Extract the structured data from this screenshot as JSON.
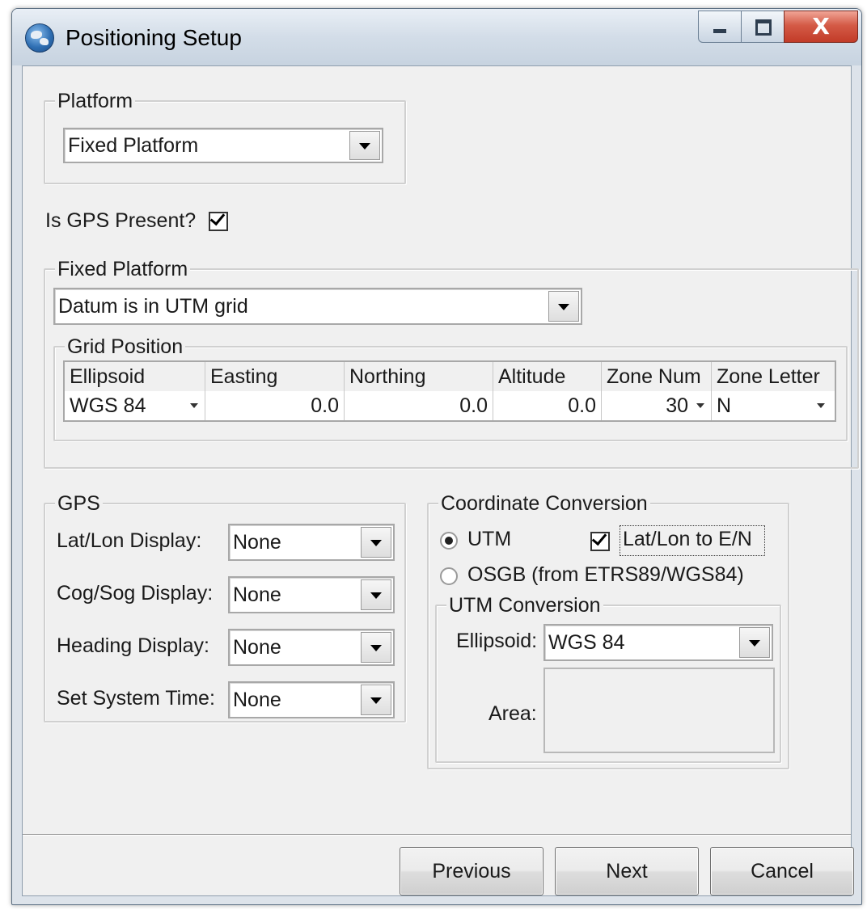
{
  "window": {
    "title": "Positioning Setup",
    "controls": {
      "minimize": "—",
      "maximize": "□",
      "close": "X"
    }
  },
  "platform": {
    "group_label": "Platform",
    "selected": "Fixed Platform"
  },
  "gps_present": {
    "label": "Is GPS Present?",
    "checked": true
  },
  "fixed_platform": {
    "group_label": "Fixed Platform",
    "datum_selected": "Datum is in UTM grid",
    "grid_position": {
      "group_label": "Grid Position",
      "columns": [
        "Ellipsoid",
        "Easting",
        "Northing",
        "Altitude",
        "Zone Num",
        "Zone Letter"
      ],
      "row": {
        "ellipsoid": "WGS 84",
        "easting": "0.0",
        "northing": "0.0",
        "altitude": "0.0",
        "zone_num": "30",
        "zone_letter": "N"
      }
    }
  },
  "gps": {
    "group_label": "GPS",
    "latlon_label": "Lat/Lon Display:",
    "latlon_value": "None",
    "cogsog_label": "Cog/Sog Display:",
    "cogsog_value": "None",
    "heading_label": "Heading Display:",
    "heading_value": "None",
    "systime_label": "Set System Time:",
    "systime_value": "None"
  },
  "coordinate_conversion": {
    "group_label": "Coordinate Conversion",
    "utm_label": "UTM",
    "utm_selected": true,
    "latlon_to_en_label": "Lat/Lon to E/N",
    "latlon_to_en_checked": true,
    "osgb_label": "OSGB (from ETRS89/WGS84)",
    "osgb_selected": false,
    "utm_conversion": {
      "group_label": "UTM Conversion",
      "ellipsoid_label": "Ellipsoid:",
      "ellipsoid_value": "WGS 84",
      "area_label": "Area:",
      "area_value": ""
    }
  },
  "buttons": {
    "previous": "Previous",
    "next": "Next",
    "cancel": "Cancel"
  },
  "colors": {
    "window_frame": "#dde3ea",
    "dialog_bg": "#f0f0f0",
    "close_button": "#c94a36"
  }
}
